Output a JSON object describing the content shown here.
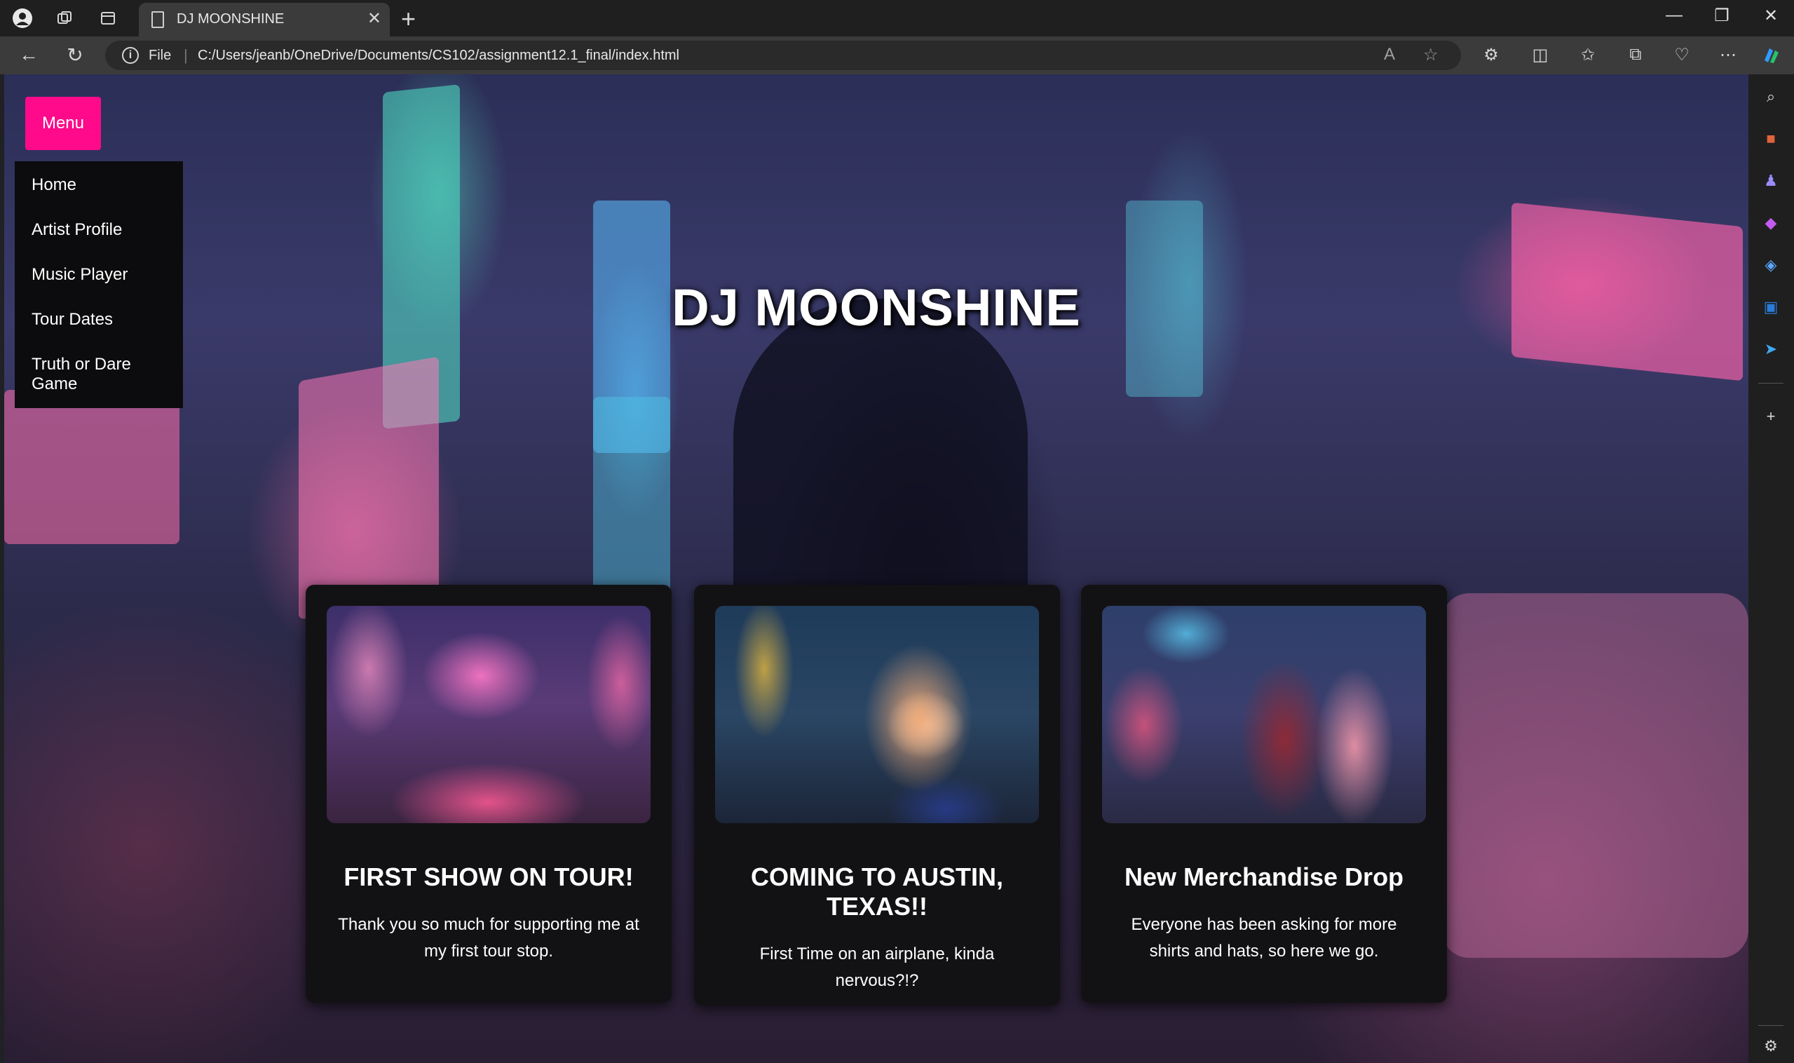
{
  "browser": {
    "tab_title": "DJ MOONSHINE",
    "scheme": "File",
    "url": "C:/Users/jeanb/OneDrive/Documents/CS102/assignment12.1_final/index.html"
  },
  "page": {
    "menu_button": "Menu",
    "menu_items": [
      "Home",
      "Artist Profile",
      "Music Player",
      "Tour Dates",
      "Truth or Dare Game"
    ],
    "hero_title": "DJ MOONSHINE",
    "cards": [
      {
        "title": "FIRST SHOW ON TOUR!",
        "text": "Thank you so much for supporting me at my first tour stop."
      },
      {
        "title": "COMING TO AUSTIN, TEXAS!!",
        "text": "First Time on an airplane, kinda nervous?!?"
      },
      {
        "title": "New Merchandise Drop",
        "text": "Everyone has been asking for more shirts and hats, so here we go."
      }
    ]
  },
  "colors": {
    "accent_pink": "#ff0a8a",
    "card_bg": "#121214",
    "menu_bg": "#0c0c0e"
  }
}
